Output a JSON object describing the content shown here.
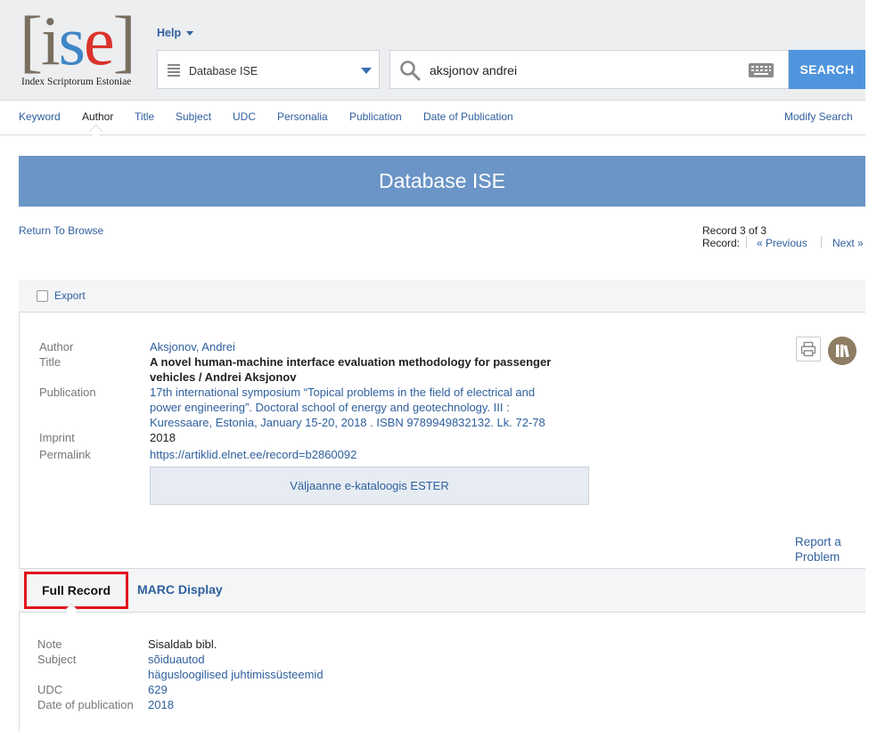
{
  "header": {
    "logo_text": "ise",
    "logo_subtitle": "Index Scriptorum Estoniae",
    "help_label": "Help",
    "database_select": "Database ISE",
    "search_value": "aksjonov andrei",
    "search_button": "SEARCH"
  },
  "nav": {
    "items": [
      "Keyword",
      "Author",
      "Title",
      "Subject",
      "UDC",
      "Personalia",
      "Publication",
      "Date of Publication"
    ],
    "active": "Author",
    "modify_search": "Modify Search"
  },
  "banner": {
    "title": "Database ISE"
  },
  "browse": {
    "return_label": "Return To Browse",
    "record_count": "Record 3 of 3",
    "record_label": "Record:",
    "previous": "« Previous",
    "next": "Next »"
  },
  "record": {
    "export_label": "Export",
    "labels": {
      "author": "Author",
      "title": "Title",
      "publication": "Publication",
      "imprint": "Imprint",
      "permalink": "Permalink"
    },
    "author": "Aksjonov, Andrei",
    "title_lines": [
      "A novel human-machine interface evaluation methodology for passenger",
      "vehicles / Andrei Aksjonov"
    ],
    "publication_lines": [
      "17th international symposium “Topical problems in the field of electrical and",
      "power engineering”. Doctoral school of energy and geotechnology. III :",
      "Kuressaare, Estonia, January 15-20, 2018 . ISBN 9789949832132. Lk. 72-78"
    ],
    "imprint": "2018",
    "permalink": "https://artiklid.elnet.ee/record=b2860092",
    "ester_button": "Väljaanne e-kataloogis ESTER",
    "report_lines": [
      "Report a",
      "Problem"
    ]
  },
  "tabs": {
    "full_record": "Full Record",
    "marc_display": "MARC Display"
  },
  "full_record": {
    "labels": {
      "note": "Note",
      "subject": "Subject",
      "udc": "UDC",
      "date_of_publication": "Date of publication"
    },
    "note": "Sisaldab bibl.",
    "subjects": [
      "sõiduautod",
      "hägusloogilised juhtimissüsteemid"
    ],
    "udc": "629",
    "date_of_publication": "2018"
  },
  "colors": {
    "brand_blue": "#6b95c6",
    "search_button": "#4f95de",
    "link": "#2f5f9e",
    "highlight_border": "#e0121c"
  }
}
